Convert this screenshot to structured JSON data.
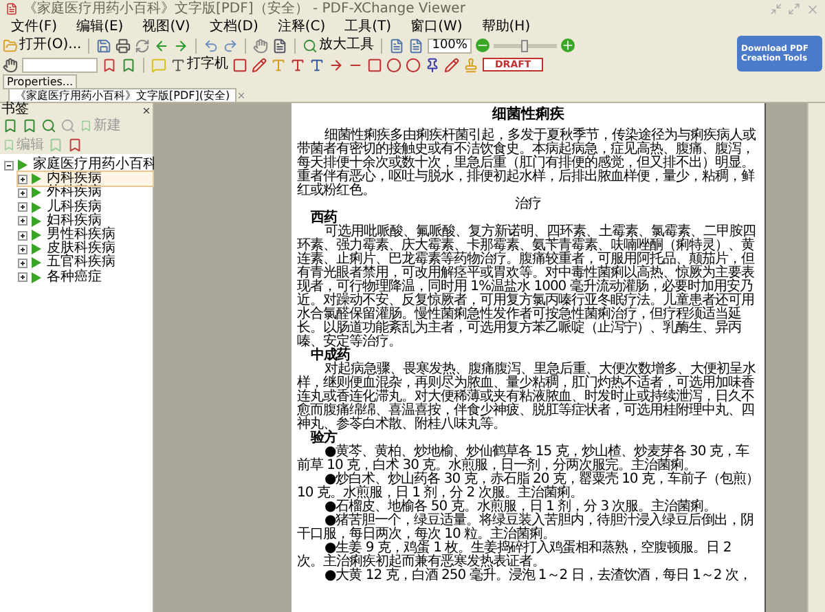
{
  "window": {
    "title": "《家庭医疗用药小百科》文字版[PDF]（安全） - PDF-XChange Viewer"
  },
  "menu": [
    "文件(F)",
    "编辑(E)",
    "视图(V)",
    "文档(D)",
    "注释(C)",
    "工具(T)",
    "窗口(W)",
    "帮助(H)"
  ],
  "toolbar": {
    "open_button": "打开(O)...",
    "zoom_tool": "放大工具",
    "zoom_level": "100%",
    "zoom_slider": {
      "level": 0.5
    },
    "typewriter": "打字机",
    "stamp": "DRAFT"
  },
  "promo": {
    "line_1": "Download PDF",
    "line_2": "Creation Tools"
  },
  "properties_tab": "Properties...",
  "document_tab": {
    "label": "《家庭医疗用药小百科》文字版[PDF](安全)",
    "selected": true
  },
  "sidebar": {
    "title": "书签",
    "buttons": [
      "新建",
      "编辑"
    ],
    "tree": [
      {
        "label": "家庭医疗用药小百科",
        "expanded": true,
        "selected": false,
        "children": [
          {
            "label": "内科疾病",
            "expanded": false,
            "selected": true
          },
          {
            "label": "外科疾病",
            "expanded": false,
            "selected": false
          },
          {
            "label": "儿科疾病",
            "expanded": false,
            "selected": false
          },
          {
            "label": "妇科疾病",
            "expanded": false,
            "selected": false
          },
          {
            "label": "男性科疾病",
            "expanded": false,
            "selected": false
          },
          {
            "label": "皮肤科疾病",
            "expanded": false,
            "selected": false
          },
          {
            "label": "五官科疾病",
            "expanded": false,
            "selected": false
          },
          {
            "label": "各种癌症",
            "expanded": false,
            "selected": false
          }
        ]
      }
    ]
  },
  "document": {
    "title": "细菌性痢疾",
    "blocks": [
      {
        "kind": "paragraph",
        "text": "细菌性痢疾多由痢疾杆菌引起，多发于夏秋季节，传染途径为与痢疾病人或带菌者有密切的接触史或有不洁饮食史。本病起病急，症见高热、腹痛、腹泻，每天排便十余次或数十次，里急后重（肛门有排便的感觉，但又排不出）明显。重者伴有恶心，呕吐与脱水，排便初起水样，后排出脓血样便，量少，粘稠，鲜红或粉红色。"
      },
      {
        "kind": "center",
        "text": "治疗"
      },
      {
        "kind": "heading",
        "text": "西药"
      },
      {
        "kind": "paragraph",
        "text": "可选用吡哌酸、氟哌酸、复方新诺明、四环素、土霉素、氯霉素、二甲胺四环素、强力霉素、庆大霉素、卡那霉素、氨苄青霉素、呋喃唑酮（痢特灵）、黄连素、止痢片、巴龙霉素等药物治疗。腹痛较重者，可服用阿托品、颠茄片，但有青光眼者禁用，可改用解痉平或胃欢等。对中毒性菌痢以高热、惊厥为主要表现者，可行物理降温，同时用 1%温盐水 1000 毫升流动灌肠，必要时加用安乃近。对躁动不安、反复惊厥者，可用复方氯丙嗪行亚冬眠疗法。儿童患者还可用水合氯醛保留灌肠。慢性菌痢急性发作者可按急性菌痢治疗，但疗程须适当延长。以肠道功能紊乱为主者，可选用复方苯乙哌啶（止泻宁）、乳酶生、异丙嗪、安定等治疗。"
      },
      {
        "kind": "heading",
        "text": "中成药"
      },
      {
        "kind": "paragraph",
        "text": "对起病急骤、畏寒发热、腹痛腹泻、里急后重、大便次数增多、大便初呈水样，继则便血混杂，再则尽为脓血、量少粘稠，肛门灼热不适者，可选用加味香连丸或香连化滞丸。对大便稀薄或夹有粘液脓血、时发时止或持续泄泻，日久不愈而腹痛绵绵、喜温喜按，伴食少神疲、脱肛等症状者，可选用桂附理中丸、四神丸、参苓白术散、附桂八味丸等。"
      },
      {
        "kind": "heading",
        "text": "验方"
      },
      {
        "kind": "paragraph",
        "text": "●黄芩、黄柏、炒地榆、炒仙鹤草各 15 克，炒山楂、炒麦芽各 30 克，车前草 10 克，白术 30 克。水煎服，日一剂，分两次服完。主治菌痢。"
      },
      {
        "kind": "paragraph",
        "text": "●炒白术、炒山药各 30 克，赤石脂 20 克，罂粟壳 10 克，车前子（包煎）10 克。水煎服，日 1 剂，分 2 次服。主治菌痢。"
      },
      {
        "kind": "paragraph",
        "text": "●石榴皮、地榆各 50 克。水煎服，日 1 剂，分 3 次服。主治菌痢。"
      },
      {
        "kind": "paragraph",
        "text": "●猪苦胆一个，绿豆适量。将绿豆装入苦胆内，待胆汁浸入绿豆后倒出，阴干口服，每日两次，每次 10 粒。主治菌痢。"
      },
      {
        "kind": "paragraph",
        "text": "●生姜 9 克，鸡蛋 1 枚。生姜捣碎打入鸡蛋相和蒸熟，空腹顿服。日 2 次。主治痢疾初起而兼有恶寒发热表证者。"
      },
      {
        "kind": "paragraph",
        "text": "●大黄 12 克，白酒 250 毫升。浸泡 1～2 日，去渣饮酒，每日 1～2 次，"
      }
    ]
  }
}
